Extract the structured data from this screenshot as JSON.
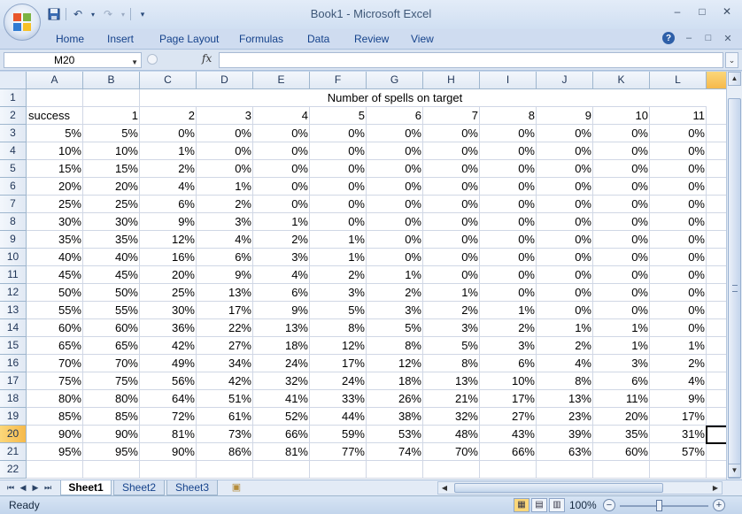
{
  "window": {
    "title": "Book1 - Microsoft Excel",
    "minimize": "–",
    "maximize": "□",
    "close": "✕"
  },
  "qat": {
    "save_icon": "floppy-disk-icon",
    "undo_icon": "undo-icon",
    "redo_icon": "redo-icon",
    "customize_icon": "dropdown-icon"
  },
  "ribbon": {
    "tabs": [
      "Home",
      "Insert",
      "Page Layout",
      "Formulas",
      "Data",
      "Review",
      "View"
    ],
    "help": "?"
  },
  "formula_bar": {
    "name_box": "M20",
    "fx": "fx",
    "value": ""
  },
  "grid": {
    "columns": [
      "A",
      "B",
      "C",
      "D",
      "E",
      "F",
      "G",
      "H",
      "I",
      "J",
      "K",
      "L"
    ],
    "rows": [
      "1",
      "2",
      "3",
      "4",
      "5",
      "6",
      "7",
      "8",
      "9",
      "10",
      "11",
      "12",
      "13",
      "14",
      "15",
      "16",
      "17",
      "18",
      "19",
      "20",
      "21",
      "22"
    ],
    "selected_row": "20",
    "active_cell": "M20",
    "merged_title": "Number of spells on target",
    "row2": [
      "success",
      "1",
      "2",
      "3",
      "4",
      "5",
      "6",
      "7",
      "8",
      "9",
      "10",
      "11"
    ],
    "data": [
      [
        "5%",
        "5%",
        "0%",
        "0%",
        "0%",
        "0%",
        "0%",
        "0%",
        "0%",
        "0%",
        "0%",
        "0%"
      ],
      [
        "10%",
        "10%",
        "1%",
        "0%",
        "0%",
        "0%",
        "0%",
        "0%",
        "0%",
        "0%",
        "0%",
        "0%"
      ],
      [
        "15%",
        "15%",
        "2%",
        "0%",
        "0%",
        "0%",
        "0%",
        "0%",
        "0%",
        "0%",
        "0%",
        "0%"
      ],
      [
        "20%",
        "20%",
        "4%",
        "1%",
        "0%",
        "0%",
        "0%",
        "0%",
        "0%",
        "0%",
        "0%",
        "0%"
      ],
      [
        "25%",
        "25%",
        "6%",
        "2%",
        "0%",
        "0%",
        "0%",
        "0%",
        "0%",
        "0%",
        "0%",
        "0%"
      ],
      [
        "30%",
        "30%",
        "9%",
        "3%",
        "1%",
        "0%",
        "0%",
        "0%",
        "0%",
        "0%",
        "0%",
        "0%"
      ],
      [
        "35%",
        "35%",
        "12%",
        "4%",
        "2%",
        "1%",
        "0%",
        "0%",
        "0%",
        "0%",
        "0%",
        "0%"
      ],
      [
        "40%",
        "40%",
        "16%",
        "6%",
        "3%",
        "1%",
        "0%",
        "0%",
        "0%",
        "0%",
        "0%",
        "0%"
      ],
      [
        "45%",
        "45%",
        "20%",
        "9%",
        "4%",
        "2%",
        "1%",
        "0%",
        "0%",
        "0%",
        "0%",
        "0%"
      ],
      [
        "50%",
        "50%",
        "25%",
        "13%",
        "6%",
        "3%",
        "2%",
        "1%",
        "0%",
        "0%",
        "0%",
        "0%"
      ],
      [
        "55%",
        "55%",
        "30%",
        "17%",
        "9%",
        "5%",
        "3%",
        "2%",
        "1%",
        "0%",
        "0%",
        "0%"
      ],
      [
        "60%",
        "60%",
        "36%",
        "22%",
        "13%",
        "8%",
        "5%",
        "3%",
        "2%",
        "1%",
        "1%",
        "0%"
      ],
      [
        "65%",
        "65%",
        "42%",
        "27%",
        "18%",
        "12%",
        "8%",
        "5%",
        "3%",
        "2%",
        "1%",
        "1%"
      ],
      [
        "70%",
        "70%",
        "49%",
        "34%",
        "24%",
        "17%",
        "12%",
        "8%",
        "6%",
        "4%",
        "3%",
        "2%"
      ],
      [
        "75%",
        "75%",
        "56%",
        "42%",
        "32%",
        "24%",
        "18%",
        "13%",
        "10%",
        "8%",
        "6%",
        "4%"
      ],
      [
        "80%",
        "80%",
        "64%",
        "51%",
        "41%",
        "33%",
        "26%",
        "21%",
        "17%",
        "13%",
        "11%",
        "9%"
      ],
      [
        "85%",
        "85%",
        "72%",
        "61%",
        "52%",
        "44%",
        "38%",
        "32%",
        "27%",
        "23%",
        "20%",
        "17%"
      ],
      [
        "90%",
        "90%",
        "81%",
        "73%",
        "66%",
        "59%",
        "53%",
        "48%",
        "43%",
        "39%",
        "35%",
        "31%"
      ],
      [
        "95%",
        "95%",
        "90%",
        "86%",
        "81%",
        "77%",
        "74%",
        "70%",
        "66%",
        "63%",
        "60%",
        "57%"
      ]
    ]
  },
  "sheets": {
    "tabs": [
      "Sheet1",
      "Sheet2",
      "Sheet3"
    ],
    "active": "Sheet1"
  },
  "status": {
    "text": "Ready",
    "zoom": "100%",
    "zoom_minus": "−",
    "zoom_plus": "+"
  }
}
